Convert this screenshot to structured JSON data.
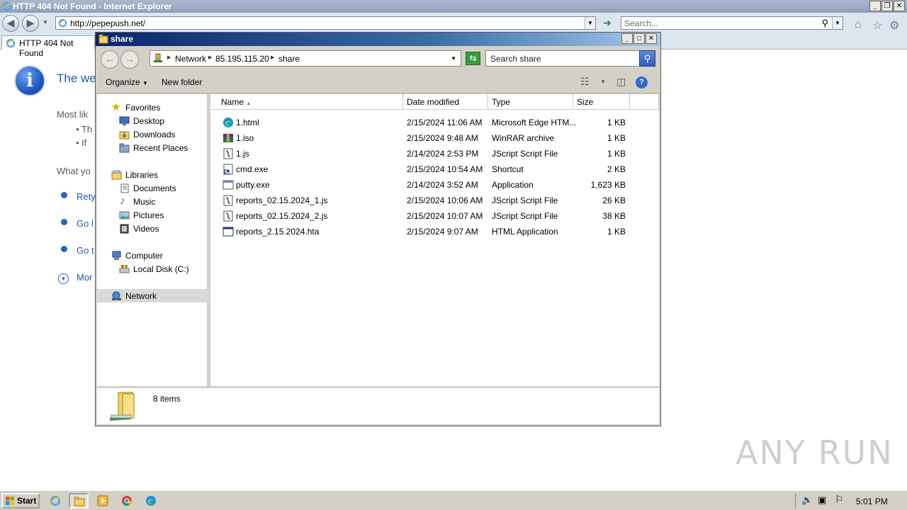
{
  "ie": {
    "title": "HTTP 404 Not Found - Internet Explorer",
    "address": "http://pepepush.net/",
    "search_placeholder": "Search...",
    "tab_label": "HTTP 404 Not Found",
    "window_buttons": [
      "_",
      "❐",
      "✕"
    ]
  },
  "page": {
    "title": "The we",
    "line1": "Most lik",
    "bullet1": "• Th",
    "bullet2": "• If",
    "line2": "What yo",
    "link1": "Rety",
    "link2": "Go l",
    "link3": "Go t",
    "more": "Mor"
  },
  "explorer": {
    "title": "share",
    "breadcrumb": [
      "Network",
      "85.195.115.20",
      "share"
    ],
    "search_placeholder": "Search share",
    "toolbar": {
      "organize": "Organize",
      "new_folder": "New folder"
    },
    "columns": [
      "Name",
      "Date modified",
      "Type",
      "Size"
    ],
    "tree": [
      {
        "label": "Favorites",
        "icon": "star-icon"
      },
      {
        "label": "Desktop",
        "icon": "desktop-icon"
      },
      {
        "label": "Downloads",
        "icon": "downloads-icon"
      },
      {
        "label": "Recent Places",
        "icon": "recent-places-icon"
      },
      {
        "label": "Libraries",
        "icon": "libraries-icon"
      },
      {
        "label": "Documents",
        "icon": "documents-icon"
      },
      {
        "label": "Music",
        "icon": "music-icon"
      },
      {
        "label": "Pictures",
        "icon": "pictures-icon"
      },
      {
        "label": "Videos",
        "icon": "videos-icon"
      },
      {
        "label": "Computer",
        "icon": "computer-icon"
      },
      {
        "label": "Local Disk (C:)",
        "icon": "disk-icon"
      },
      {
        "label": "Network",
        "icon": "network-icon"
      }
    ],
    "files": [
      {
        "name": "1.html",
        "date": "2/15/2024 11:06 AM",
        "type": "Microsoft Edge HTM...",
        "size": "1 KB",
        "icon": "edge-html-icon"
      },
      {
        "name": "1.iso",
        "date": "2/15/2024 9:48 AM",
        "type": "WinRAR archive",
        "size": "1 KB",
        "icon": "winrar-icon"
      },
      {
        "name": "1.js",
        "date": "2/14/2024 2:53 PM",
        "type": "JScript Script File",
        "size": "1 KB",
        "icon": "jscript-icon"
      },
      {
        "name": "cmd.exe",
        "date": "2/15/2024 10:54 AM",
        "type": "Shortcut",
        "size": "2 KB",
        "icon": "shortcut-icon"
      },
      {
        "name": "putty.exe",
        "date": "2/14/2024 3:52 AM",
        "type": "Application",
        "size": "1,623 KB",
        "icon": "application-icon"
      },
      {
        "name": "reports_02.15.2024_1.js",
        "date": "2/15/2024 10:06 AM",
        "type": "JScript Script File",
        "size": "26 KB",
        "icon": "jscript-icon"
      },
      {
        "name": "reports_02.15.2024_2.js",
        "date": "2/15/2024 10:07 AM",
        "type": "JScript Script File",
        "size": "38 KB",
        "icon": "jscript-icon"
      },
      {
        "name": "reports_2.15.2024.hta",
        "date": "2/15/2024 9:07 AM",
        "type": "HTML Application",
        "size": "1 KB",
        "icon": "hta-icon"
      }
    ],
    "status": "8 items"
  },
  "watermark": "ANY RUN",
  "taskbar": {
    "start": "Start",
    "clock": "5:01 PM"
  }
}
